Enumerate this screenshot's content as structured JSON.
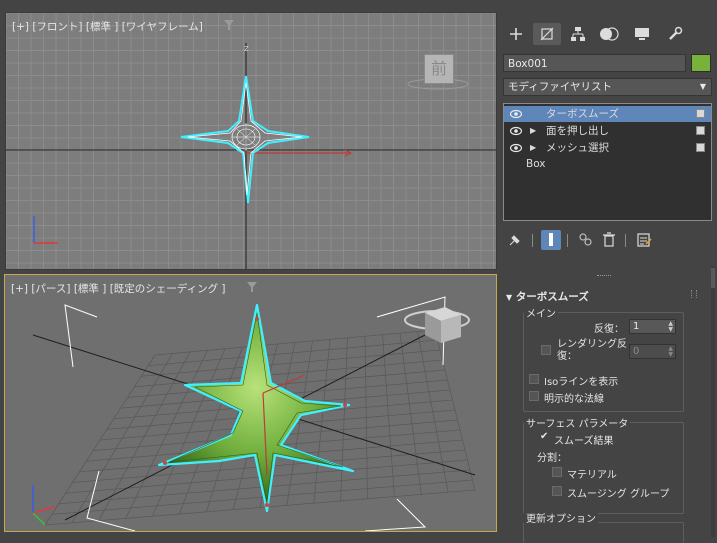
{
  "viewports": {
    "front": {
      "label": "[+] [フロント] [標準 ] [ワイヤフレーム]",
      "axis_top": "Z",
      "viewcube_face": "前"
    },
    "perspective": {
      "label": "[+] [パース] [標準 ] [既定のシェーディング ]"
    }
  },
  "panel": {
    "tabs": [
      {
        "icon": "create-plus-icon"
      },
      {
        "icon": "modify-icon"
      },
      {
        "icon": "hierarchy-icon"
      },
      {
        "icon": "motion-icon"
      },
      {
        "icon": "display-icon"
      },
      {
        "icon": "utilities-wrench-icon"
      }
    ],
    "object_name": "Box001",
    "object_color": "#79b23a",
    "modifier_list": "モディファイヤリスト",
    "stack": [
      {
        "label": "ターボスムーズ",
        "selected": true
      },
      {
        "label": "面を押し出し",
        "selected": false
      },
      {
        "label": "メッシュ選択",
        "selected": false
      }
    ],
    "stack_base": "Box"
  },
  "turbosmooth": {
    "title": "ターボスムーズ",
    "main_group": "メイン",
    "iterations_label": "反復：",
    "iterations_value": "1",
    "render_iter_label_1": "レンダリング反",
    "render_iter_label_2": "復：",
    "render_iter_value": "0",
    "isoline_label": "Isoラインを表示",
    "explicit_normals_label": "明示的な法線",
    "surface_group": "サーフェス パラメータ",
    "smooth_result_label": "スムーズ結果",
    "separate_label": "分割：",
    "materials_label": "マテリアル",
    "smoothing_groups_label": "スムージング グループ",
    "update_group": "更新オプション"
  },
  "colors": {
    "accent_select": "#5f86b8",
    "wire_highlight": "#3ff0ff",
    "mesh_green": "#6fae3c",
    "active_border": "#c7a84a"
  }
}
